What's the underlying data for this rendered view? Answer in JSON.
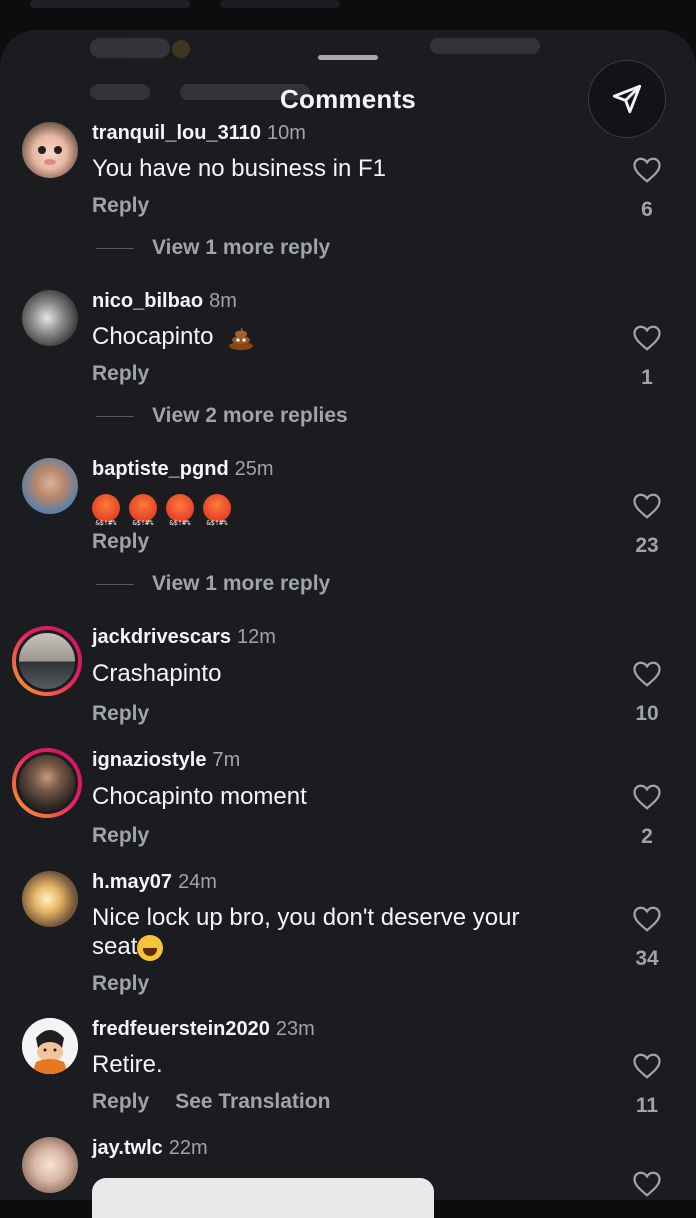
{
  "header": {
    "title": "Comments"
  },
  "comments": [
    {
      "username": "tranquil_lou_3110",
      "time": "10m",
      "text": "You have no business in F1",
      "reply": "Reply",
      "likes": "6",
      "more_replies": "View 1 more reply"
    },
    {
      "username": "nico_bilbao",
      "time": "8m",
      "text": "Chocapinto",
      "reply": "Reply",
      "likes": "1",
      "more_replies": "View 2 more replies"
    },
    {
      "username": "baptiste_pgnd",
      "time": "25m",
      "text": "",
      "reply": "Reply",
      "likes": "23",
      "more_replies": "View 1 more reply"
    },
    {
      "username": "jackdrivescars",
      "time": "12m",
      "text": "Crashapinto",
      "reply": "Reply",
      "likes": "10"
    },
    {
      "username": "ignaziostyle",
      "time": "7m",
      "text": "Chocapinto moment",
      "reply": "Reply",
      "likes": "2"
    },
    {
      "username": "h.may07",
      "time": "24m",
      "text_line1": "Nice lock up bro, you don't deserve your",
      "text_line2": "seat",
      "reply": "Reply",
      "likes": "34"
    },
    {
      "username": "fredfeuerstein2020",
      "time": "23m",
      "text": "Retire.",
      "reply": "Reply",
      "translate": "See Translation",
      "likes": "11"
    },
    {
      "username": "jay.twlc",
      "time": "22m"
    }
  ]
}
